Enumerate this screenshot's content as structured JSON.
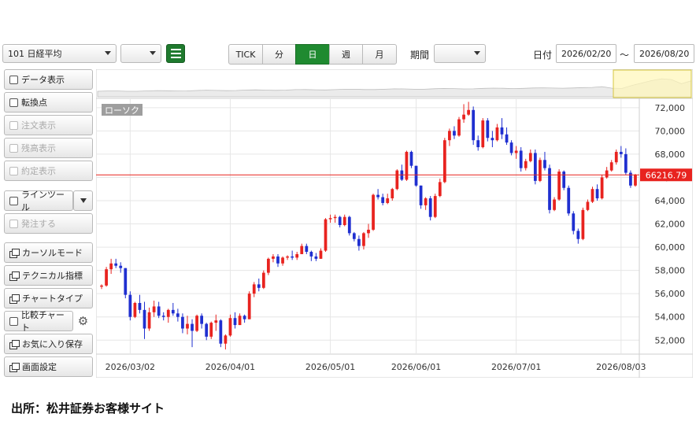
{
  "toolbar": {
    "symbol": "101 日経平均",
    "secondary_select": "",
    "intervals": [
      "TICK",
      "分",
      "日",
      "週",
      "月"
    ],
    "active_interval": "日",
    "period_label": "期間",
    "period_value": "",
    "date_label": "日付",
    "date_from": "2026/02/20",
    "date_sep": "～",
    "date_to": "2026/08/20"
  },
  "sidebar": {
    "items": [
      {
        "label": "データ表示",
        "icon": "checkbox-icon",
        "enabled": true
      },
      {
        "label": "転換点",
        "icon": "checkbox-icon",
        "enabled": true
      },
      {
        "label": "注文表示",
        "icon": "checkbox-icon",
        "enabled": false
      },
      {
        "label": "残高表示",
        "icon": "checkbox-icon",
        "enabled": false
      },
      {
        "label": "約定表示",
        "icon": "checkbox-icon",
        "enabled": false
      },
      {
        "label": "ラインツール",
        "icon": "checkbox-icon",
        "enabled": true
      },
      {
        "label": "発注する",
        "icon": "checkbox-icon",
        "enabled": false
      },
      {
        "label": "カーソルモード",
        "icon": "window-icon",
        "enabled": true
      },
      {
        "label": "テクニカル指標",
        "icon": "window-icon",
        "enabled": true
      },
      {
        "label": "チャートタイプ",
        "icon": "window-icon",
        "enabled": true
      },
      {
        "label": "比較チャート",
        "icon": "checkbox-icon",
        "enabled": true
      },
      {
        "label": "お気に入り保存",
        "icon": "window-icon",
        "enabled": true
      },
      {
        "label": "画面設定",
        "icon": "window-icon",
        "enabled": true
      }
    ]
  },
  "chart_data": {
    "type": "candlestick",
    "series_label": "ローソク",
    "y_ticks": [
      72000,
      70000,
      68000,
      66000,
      64000,
      62000,
      60000,
      58000,
      56000,
      54000,
      52000
    ],
    "y_tick_labels": [
      "72,000",
      "70,000",
      "68,000",
      "66,000",
      "64,000",
      "62,000",
      "60,000",
      "58,000",
      "56,000",
      "54,000",
      "52,000"
    ],
    "ylim": [
      50800,
      72800
    ],
    "x_labels": [
      "2026/03/02",
      "2026/04/01",
      "2026/05/01",
      "2026/06/01",
      "2026/07/01",
      "2026/08/03"
    ],
    "x_label_index": [
      6,
      27,
      48,
      66,
      87,
      109
    ],
    "current_price": 66216.79,
    "current_price_label": "66216.79",
    "up_color": "#e8231f",
    "down_color": "#1f2fd0",
    "candles": [
      [
        56600,
        56800,
        56400,
        56700
      ],
      [
        56700,
        58300,
        56600,
        58100
      ],
      [
        58100,
        59000,
        57700,
        58600
      ],
      [
        58600,
        59000,
        58200,
        58400
      ],
      [
        58400,
        58700,
        57800,
        58200
      ],
      [
        58200,
        58200,
        55600,
        55900
      ],
      [
        55900,
        56200,
        53700,
        54000
      ],
      [
        54000,
        55300,
        53900,
        55200
      ],
      [
        55200,
        55900,
        54300,
        54600
      ],
      [
        54600,
        55300,
        52100,
        53000
      ],
      [
        53000,
        54800,
        52800,
        54400
      ],
      [
        54400,
        55400,
        54000,
        54900
      ],
      [
        54900,
        55300,
        53900,
        54100
      ],
      [
        54100,
        54400,
        53700,
        54000
      ],
      [
        54000,
        54700,
        53500,
        54600
      ],
      [
        54600,
        55200,
        54100,
        54300
      ],
      [
        54300,
        54700,
        53600,
        54000
      ],
      [
        54000,
        54300,
        52600,
        53000
      ],
      [
        53000,
        54100,
        52500,
        53400
      ],
      [
        53400,
        53800,
        51400,
        52800
      ],
      [
        52800,
        54200,
        52700,
        54100
      ],
      [
        54100,
        54300,
        53000,
        53400
      ],
      [
        53400,
        53500,
        52000,
        52300
      ],
      [
        52300,
        53600,
        52100,
        53500
      ],
      [
        53500,
        54200,
        52800,
        53700
      ],
      [
        53700,
        53800,
        51400,
        51700
      ],
      [
        51700,
        52500,
        51200,
        52400
      ],
      [
        52400,
        54200,
        52300,
        53900
      ],
      [
        53900,
        54400,
        53000,
        53300
      ],
      [
        53300,
        54300,
        53300,
        54100
      ],
      [
        54100,
        54200,
        53500,
        53800
      ],
      [
        53800,
        56200,
        53800,
        56000
      ],
      [
        56000,
        57000,
        55700,
        56800
      ],
      [
        56800,
        57300,
        56200,
        56500
      ],
      [
        56500,
        58000,
        56400,
        57800
      ],
      [
        57800,
        59100,
        57600,
        59000
      ],
      [
        59000,
        59400,
        58700,
        59200
      ],
      [
        59200,
        59400,
        58300,
        58600
      ],
      [
        58600,
        59200,
        58400,
        59100
      ],
      [
        59100,
        59300,
        58900,
        59200
      ],
      [
        59200,
        59700,
        58900,
        59100
      ],
      [
        59100,
        59600,
        58900,
        59400
      ],
      [
        59400,
        60300,
        59400,
        60100
      ],
      [
        60100,
        60300,
        59400,
        59600
      ],
      [
        59600,
        59700,
        58800,
        59200
      ],
      [
        59200,
        59500,
        58800,
        59000
      ],
      [
        59000,
        59900,
        59000,
        59700
      ],
      [
        59700,
        62500,
        59600,
        62400
      ],
      [
        62400,
        62800,
        62100,
        62500
      ],
      [
        62500,
        62800,
        62100,
        62600
      ],
      [
        62600,
        62700,
        61700,
        61900
      ],
      [
        61900,
        62800,
        61800,
        62600
      ],
      [
        62600,
        62700,
        61000,
        61200
      ],
      [
        61200,
        61300,
        60500,
        60700
      ],
      [
        60700,
        61000,
        59700,
        60100
      ],
      [
        60100,
        61300,
        59800,
        61200
      ],
      [
        61200,
        62000,
        60800,
        61500
      ],
      [
        61500,
        64600,
        61400,
        64500
      ],
      [
        64500,
        65000,
        64100,
        64300
      ],
      [
        64300,
        64600,
        63600,
        63800
      ],
      [
        63800,
        64600,
        63700,
        64200
      ],
      [
        64200,
        65100,
        64000,
        65000
      ],
      [
        65000,
        66700,
        64900,
        66600
      ],
      [
        66600,
        67100,
        65700,
        65800
      ],
      [
        65800,
        68300,
        65700,
        68200
      ],
      [
        68200,
        68300,
        66800,
        67000
      ],
      [
        67000,
        67000,
        65200,
        65300
      ],
      [
        65300,
        65300,
        63300,
        63600
      ],
      [
        63600,
        64300,
        63200,
        64200
      ],
      [
        64200,
        64400,
        62300,
        62600
      ],
      [
        62600,
        64600,
        62500,
        64400
      ],
      [
        64400,
        65900,
        64300,
        65600
      ],
      [
        65600,
        69400,
        65500,
        69200
      ],
      [
        69200,
        70200,
        68700,
        70000
      ],
      [
        70000,
        70400,
        69300,
        69600
      ],
      [
        69600,
        71200,
        69500,
        71000
      ],
      [
        71000,
        72300,
        70700,
        71400
      ],
      [
        71400,
        72500,
        71300,
        71800
      ],
      [
        71800,
        72100,
        68800,
        69200
      ],
      [
        69200,
        69600,
        68300,
        68600
      ],
      [
        68600,
        71100,
        68500,
        70900
      ],
      [
        70900,
        71100,
        69100,
        69400
      ],
      [
        69400,
        70000,
        68600,
        69200
      ],
      [
        69200,
        70600,
        69100,
        70300
      ],
      [
        70300,
        71100,
        69300,
        69700
      ],
      [
        69700,
        70300,
        68800,
        69000
      ],
      [
        69000,
        69200,
        67900,
        68100
      ],
      [
        68100,
        68700,
        67600,
        68300
      ],
      [
        68300,
        68600,
        66500,
        66800
      ],
      [
        66800,
        67600,
        66600,
        67400
      ],
      [
        67400,
        68400,
        67300,
        68100
      ],
      [
        68100,
        68400,
        65400,
        65700
      ],
      [
        65700,
        67700,
        65600,
        67500
      ],
      [
        67500,
        68200,
        66600,
        66800
      ],
      [
        66800,
        67100,
        62900,
        63200
      ],
      [
        63200,
        64300,
        63100,
        64100
      ],
      [
        64100,
        66700,
        64000,
        66500
      ],
      [
        66500,
        66600,
        64900,
        65100
      ],
      [
        65100,
        65300,
        62700,
        62900
      ],
      [
        62900,
        63100,
        61100,
        61400
      ],
      [
        61400,
        61600,
        60300,
        60700
      ],
      [
        60700,
        63400,
        60600,
        63200
      ],
      [
        63200,
        64100,
        63100,
        63900
      ],
      [
        63900,
        65200,
        63800,
        65000
      ],
      [
        65000,
        65400,
        64000,
        64200
      ],
      [
        64200,
        66200,
        64100,
        66000
      ],
      [
        66000,
        66900,
        65900,
        66600
      ],
      [
        66600,
        67500,
        66500,
        67300
      ],
      [
        67300,
        68400,
        67100,
        68200
      ],
      [
        68200,
        68700,
        67700,
        68000
      ],
      [
        68000,
        68500,
        66200,
        66400
      ],
      [
        66400,
        66600,
        65100,
        65300
      ],
      [
        65300,
        66300,
        65200,
        66200
      ]
    ]
  }
}
